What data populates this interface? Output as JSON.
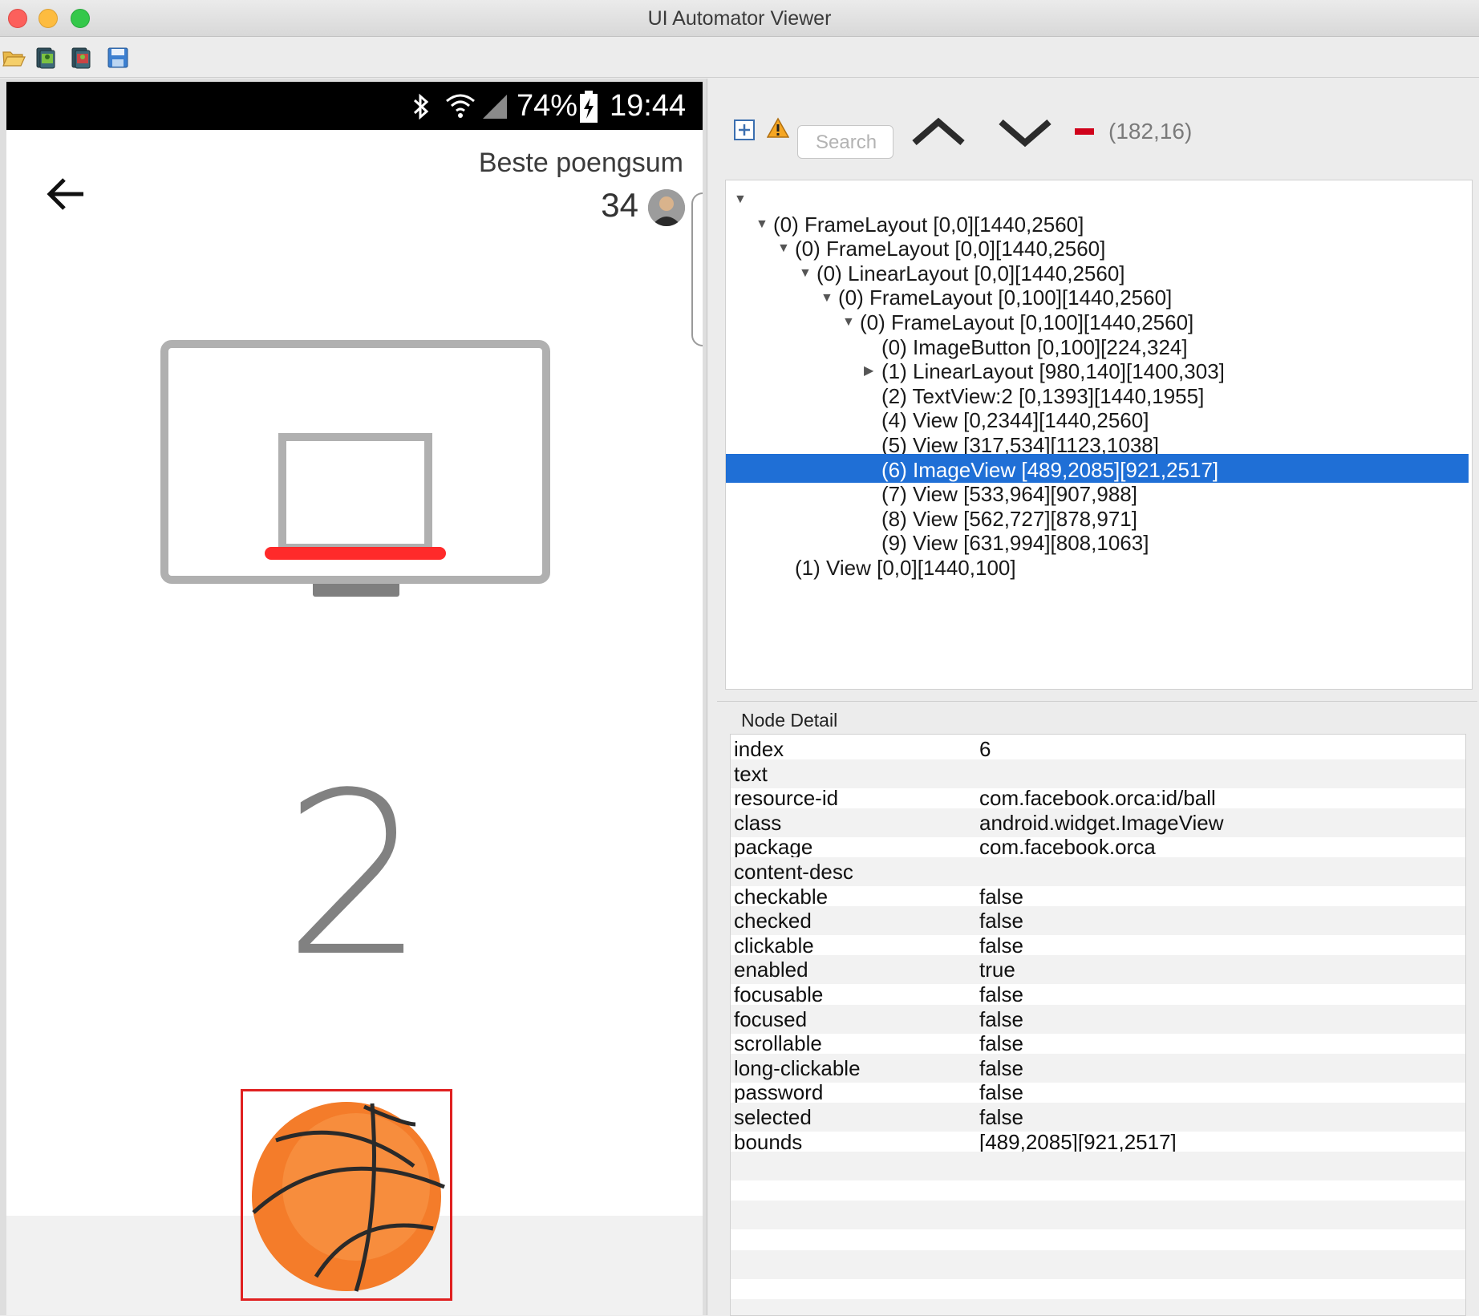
{
  "window": {
    "title": "UI Automator Viewer"
  },
  "toolbar": {
    "icons": [
      "open-folder-icon",
      "device-screenshot-icon",
      "device-screenshot-compressed-icon",
      "save-icon"
    ]
  },
  "phone": {
    "status": {
      "battery": "74%",
      "time": "19:44",
      "icons": [
        "bluetooth-icon",
        "wifi-icon",
        "signal-icon",
        "battery-charging-icon"
      ]
    },
    "best_label": "Beste poengsum",
    "best_score": "34",
    "score": "2"
  },
  "inspector": {
    "search_placeholder": "Search",
    "coords": "(182,16)",
    "tree": [
      {
        "label": "",
        "depth": 0,
        "toggle": "open"
      },
      {
        "label": "(0) FrameLayout [0,0][1440,2560]",
        "depth": 1,
        "toggle": "open"
      },
      {
        "label": "(0) FrameLayout [0,0][1440,2560]",
        "depth": 2,
        "toggle": "open"
      },
      {
        "label": "(0) LinearLayout [0,0][1440,2560]",
        "depth": 3,
        "toggle": "open"
      },
      {
        "label": "(0) FrameLayout [0,100][1440,2560]",
        "depth": 4,
        "toggle": "open"
      },
      {
        "label": "(0) FrameLayout [0,100][1440,2560]",
        "depth": 5,
        "toggle": "open"
      },
      {
        "label": "(0) ImageButton [0,100][224,324]",
        "depth": 6,
        "toggle": "none"
      },
      {
        "label": "(1) LinearLayout [980,140][1400,303]",
        "depth": 6,
        "toggle": "closed"
      },
      {
        "label": "(2) TextView:2 [0,1393][1440,1955]",
        "depth": 6,
        "toggle": "none"
      },
      {
        "label": "(4) View [0,2344][1440,2560]",
        "depth": 6,
        "toggle": "none"
      },
      {
        "label": "(5) View [317,534][1123,1038]",
        "depth": 6,
        "toggle": "none"
      },
      {
        "label": "(6) ImageView [489,2085][921,2517]",
        "depth": 6,
        "toggle": "none",
        "selected": true
      },
      {
        "label": "(7) View [533,964][907,988]",
        "depth": 6,
        "toggle": "none"
      },
      {
        "label": "(8) View [562,727][878,971]",
        "depth": 6,
        "toggle": "none"
      },
      {
        "label": "(9) View [631,994][808,1063]",
        "depth": 6,
        "toggle": "none"
      },
      {
        "label": "(1) View [0,0][1440,100]",
        "depth": 2,
        "toggle": "none"
      }
    ],
    "detail_title": "Node Detail",
    "details": [
      {
        "key": "index",
        "value": "6"
      },
      {
        "key": "text",
        "value": ""
      },
      {
        "key": "resource-id",
        "value": "com.facebook.orca:id/ball"
      },
      {
        "key": "class",
        "value": "android.widget.ImageView"
      },
      {
        "key": "package",
        "value": "com.facebook.orca"
      },
      {
        "key": "content-desc",
        "value": ""
      },
      {
        "key": "checkable",
        "value": "false"
      },
      {
        "key": "checked",
        "value": "false"
      },
      {
        "key": "clickable",
        "value": "false"
      },
      {
        "key": "enabled",
        "value": "true"
      },
      {
        "key": "focusable",
        "value": "false"
      },
      {
        "key": "focused",
        "value": "false"
      },
      {
        "key": "scrollable",
        "value": "false"
      },
      {
        "key": "long-clickable",
        "value": "false"
      },
      {
        "key": "password",
        "value": "false"
      },
      {
        "key": "selected",
        "value": "false"
      },
      {
        "key": "bounds",
        "value": "[489,2085][921,2517]"
      }
    ]
  },
  "colors": {
    "selection": "#1f6fd6",
    "rim": "#ff2a2a",
    "highlight": "#e02020",
    "ball": "#f47c2a"
  }
}
